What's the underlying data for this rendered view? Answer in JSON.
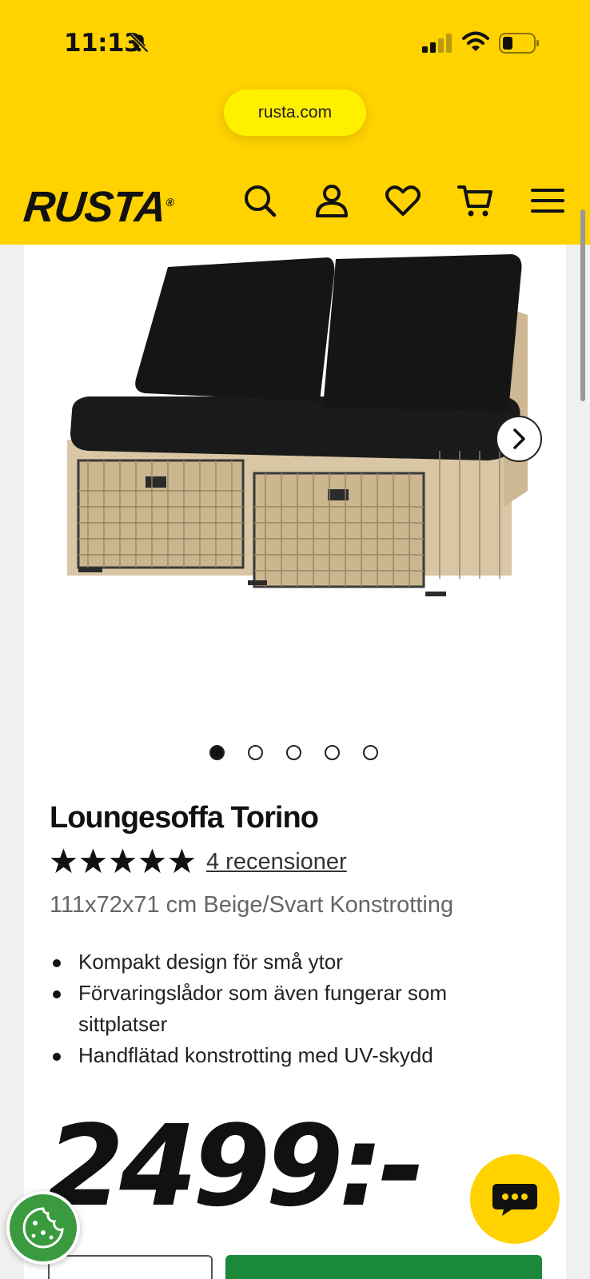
{
  "status_bar": {
    "time": "11:13"
  },
  "browser": {
    "url": "rusta.com"
  },
  "header": {
    "logo": "RUSTA",
    "logo_mark": "®"
  },
  "product": {
    "title": "Loungesoffa Torino",
    "rating": 5,
    "reviews_label": "4 recensioner",
    "subtitle": "111x72x71 cm Beige/Svart Konstrotting",
    "features": [
      "Kompakt design för små ytor",
      "Förvaringslådor som även fungerar som sittplatser",
      "Handflätad konstrotting med UV-skydd"
    ],
    "price": "2499:-",
    "gallery_count": 5,
    "gallery_active": 0
  },
  "colors": {
    "brand_yellow": "#ffd200",
    "cta_green": "#1a8a3a",
    "cookie_green": "#3a9a3e"
  }
}
